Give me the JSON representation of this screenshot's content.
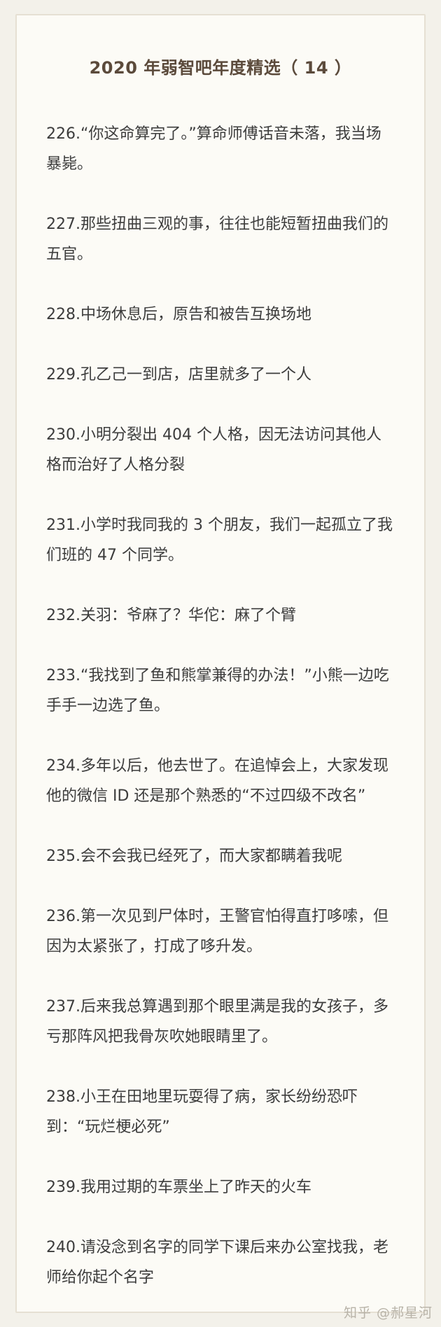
{
  "title": "2020 年弱智吧年度精选（ 14 ）",
  "items": [
    "226.“你这命算完了。”算命师傅话音未落，我当场暴毙。",
    "227.那些扭曲三观的事，往往也能短暂扭曲我们的五官。",
    "228.中场休息后，原告和被告互换场地",
    "229.孔乙己一到店，店里就多了一个人",
    "230.小明分裂出 404 个人格，因无法访问其他人格而治好了人格分裂",
    "231.小学时我同我的 3 个朋友，我们一起孤立了我们班的 47 个同学。",
    "232.关羽：爷麻了？华佗：麻了个臂",
    "233.“我找到了鱼和熊掌兼得的办法！”小熊一边吃手手一边选了鱼。",
    "234.多年以后，他去世了。在追悼会上，大家发现他的微信 ID 还是那个熟悉的“不过四级不改名”",
    "235.会不会我已经死了，而大家都瞒着我呢",
    "236.第一次见到尸体时，王警官怕得直打哆嗦，但因为太紧张了，打成了哆升发。",
    "237.后来我总算遇到那个眼里满是我的女孩子，多亏那阵风把我骨灰吹她眼睛里了。",
    "238.小王在田地里玩耍得了病，家长纷纷恐吓到：“玩烂梗必死”",
    "239.我用过期的车票坐上了昨天的火车",
    "240.请没念到名字的同学下课后来办公室找我，老师给你起个名字"
  ],
  "watermark": "知乎 @郝星河"
}
